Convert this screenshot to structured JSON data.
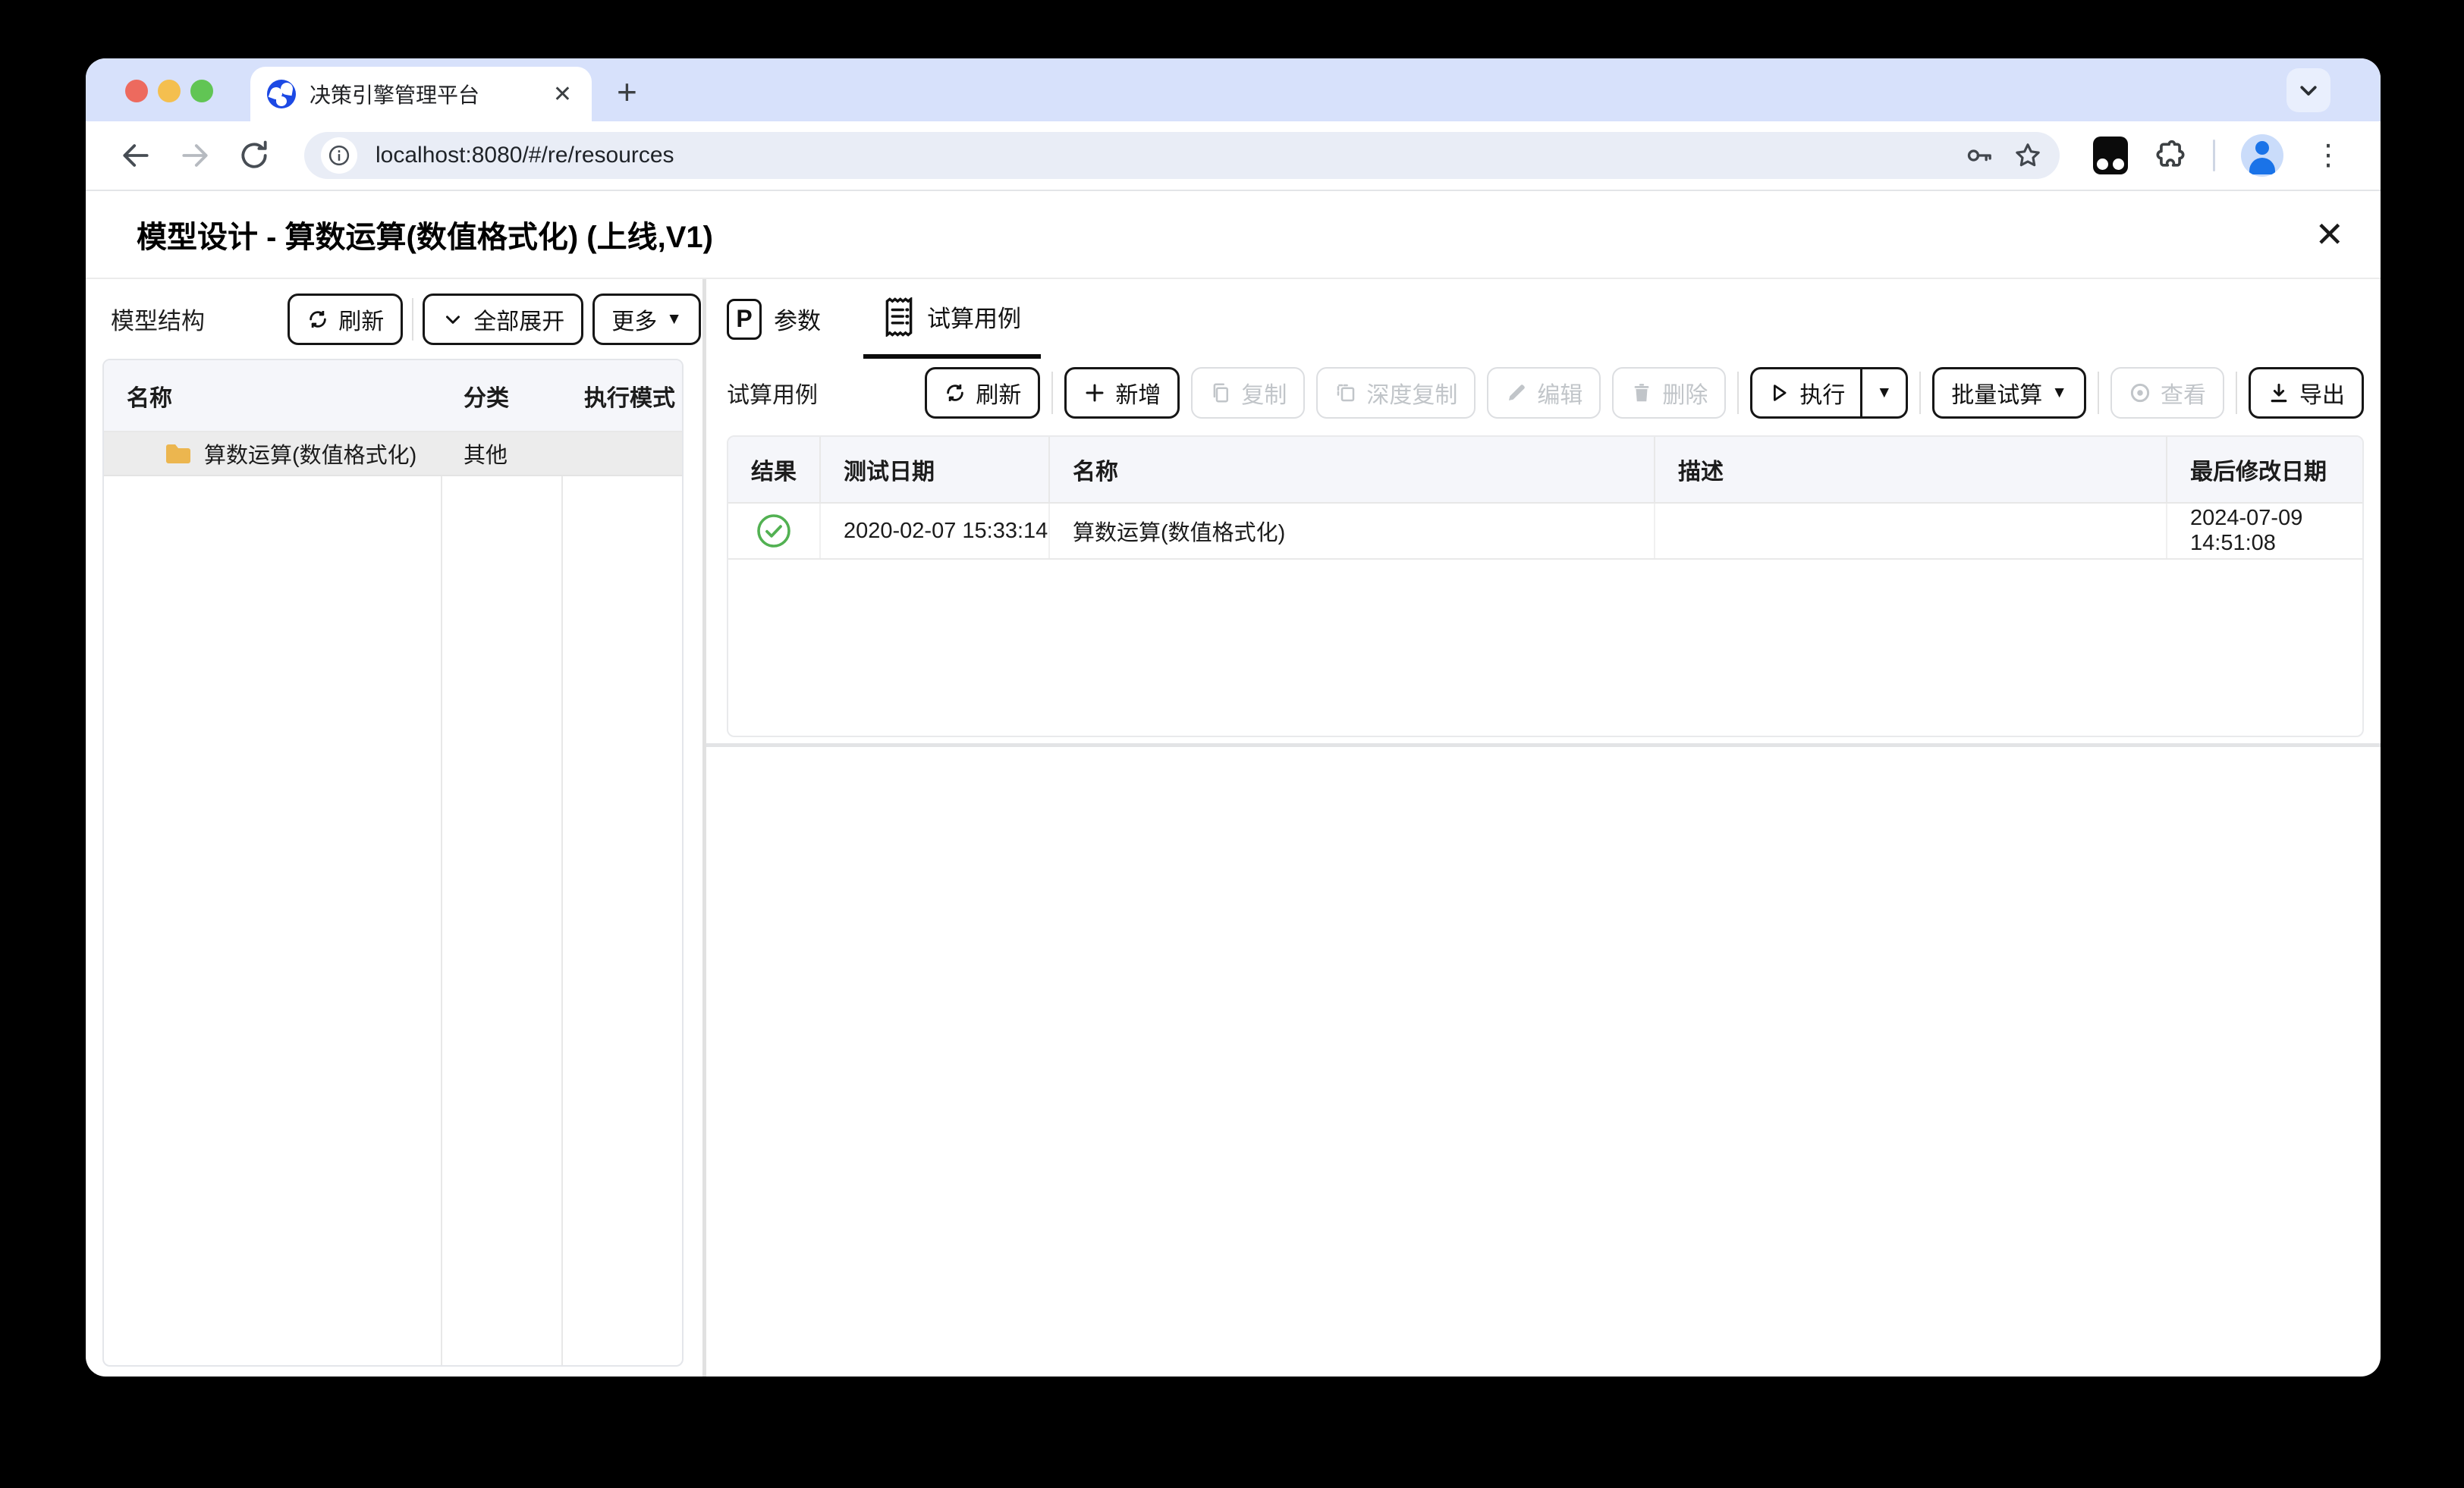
{
  "browser": {
    "tab_title": "决策引擎管理平台",
    "url": "localhost:8080/#/re/resources"
  },
  "icons": {
    "close": "✕",
    "plus": "+",
    "kebab": "⋮",
    "caret_down": "▼"
  },
  "page": {
    "title": "模型设计 - 算数运算(数值格式化) (上线,V1)"
  },
  "left_panel": {
    "title": "模型结构",
    "buttons": {
      "refresh": "刷新",
      "expand_all": "全部展开",
      "more": "更多"
    },
    "table": {
      "headers": [
        "名称",
        "分类",
        "执行模式"
      ],
      "rows": [
        {
          "name": "算数运算(数值格式化)",
          "category": "其他",
          "exec_mode": ""
        }
      ]
    }
  },
  "right_panel": {
    "tabs": [
      {
        "label": "参数",
        "icon_letter": "P"
      },
      {
        "label": "试算用例"
      }
    ],
    "section_title": "试算用例",
    "toolbar": {
      "refresh": "刷新",
      "add": "新增",
      "copy": "复制",
      "deep_copy": "深度复制",
      "edit": "编辑",
      "delete": "删除",
      "run": "执行",
      "batch_run": "批量试算",
      "view": "查看",
      "export": "导出"
    },
    "table": {
      "headers": [
        "结果",
        "测试日期",
        "名称",
        "描述",
        "最后修改日期"
      ],
      "rows": [
        {
          "result": "success",
          "test_date": "2020-02-07 15:33:14",
          "name": "算数运算(数值格式化)",
          "description": "",
          "last_modified": "2024-07-09 14:51:08"
        }
      ]
    }
  },
  "colors": {
    "tab_strip": "#d7e1fb",
    "success_green": "#52b152",
    "folder_yellow": "#ecb64f",
    "favicon_blue": "#1c49e4",
    "avatar_blue": "#1a73e8"
  }
}
